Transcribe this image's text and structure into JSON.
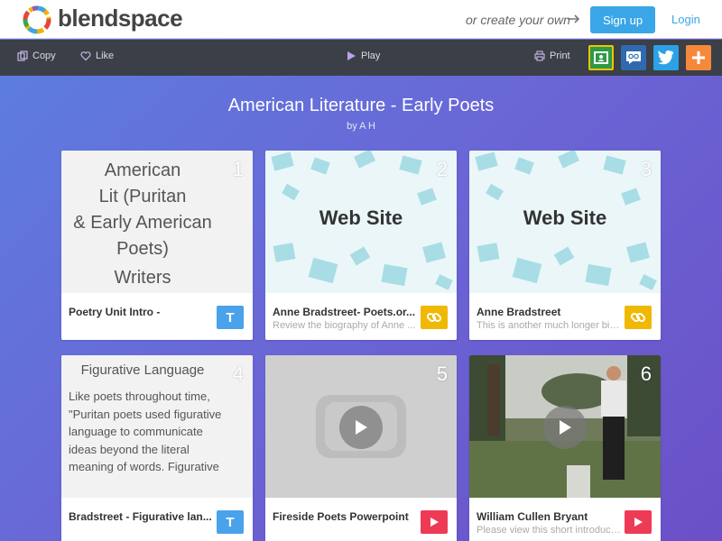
{
  "header": {
    "brand": "blendspace",
    "create_prompt": "or create your own",
    "signup_label": "Sign up",
    "login_label": "Login"
  },
  "toolbar": {
    "copy_label": "Copy",
    "like_label": "Like",
    "play_label": "Play",
    "print_label": "Print",
    "share_buttons": [
      {
        "icon": "google-classroom-icon",
        "color": "#2e9a45"
      },
      {
        "icon": "edmodo-icon",
        "color": "#2f6ab0"
      },
      {
        "icon": "twitter-icon",
        "color": "#2ea1e6"
      },
      {
        "icon": "add-icon",
        "color": "#f5883a"
      }
    ]
  },
  "lesson": {
    "title": "American Literature - Early Poets",
    "byline": "by A H"
  },
  "tiles": [
    {
      "number": "1",
      "kind": "text",
      "preview_lines": [
        "American",
        "Lit (Puritan",
        "& Early American",
        "Poets)"
      ],
      "preview_extra": "Writers",
      "title": "Poetry Unit Intro -",
      "description": "",
      "badge": "T"
    },
    {
      "number": "2",
      "kind": "web",
      "preview_label": "Web Site",
      "title": "Anne Bradstreet- Poets.or...",
      "description": "Review the biography of Anne ...",
      "badge": "link"
    },
    {
      "number": "3",
      "kind": "web",
      "preview_label": "Web Site",
      "title": "Anne Bradstreet",
      "description": "This is another much longer bio...",
      "badge": "link"
    },
    {
      "number": "4",
      "kind": "text",
      "preview_heading": "Figurative Language",
      "preview_body": "Like poets throughout time, \"Puritan poets used figurative language to communicate ideas beyond the literal meaning of words. Figurative",
      "title": "Bradstreet - Figurative lan...",
      "description": "",
      "badge": "T"
    },
    {
      "number": "5",
      "kind": "video",
      "title": "Fireside Poets Powerpoint",
      "description": "",
      "badge": "video"
    },
    {
      "number": "6",
      "kind": "video",
      "title": "William Cullen Bryant",
      "description": "Please view this short introduct...",
      "badge": "video"
    }
  ],
  "colors": {
    "accent": "#3aa6e8",
    "toolbar": "#3b4048",
    "text_badge": "#4aa3ea",
    "link_badge": "#f0b800",
    "video_badge": "#ee3b55"
  }
}
